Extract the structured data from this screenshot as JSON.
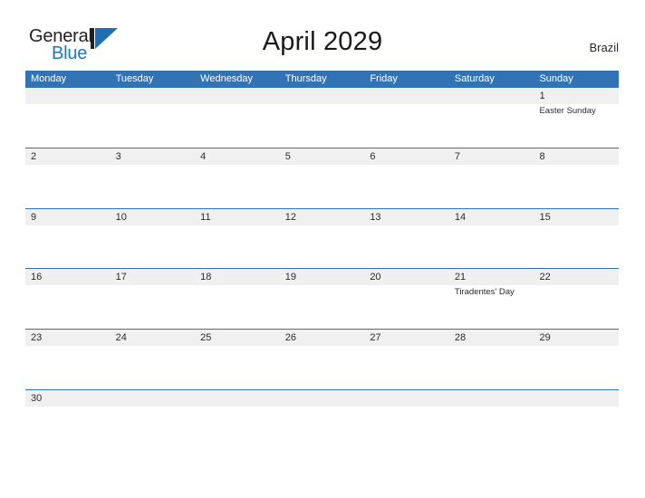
{
  "header": {
    "logo": {
      "word_one": "General",
      "word_two": "Blue",
      "mark": "triangle-logo-mark"
    },
    "title": "April 2029",
    "region": "Brazil"
  },
  "colors": {
    "header_blue": "#3173b4",
    "logo_blue": "#1878c8",
    "band_gray": "#f0f0f0",
    "text_dark": "#2b2b2b"
  },
  "calendar": {
    "weekdays": [
      "Monday",
      "Tuesday",
      "Wednesday",
      "Thursday",
      "Friday",
      "Saturday",
      "Sunday"
    ],
    "weeks": [
      [
        {
          "date": "",
          "event": ""
        },
        {
          "date": "",
          "event": ""
        },
        {
          "date": "",
          "event": ""
        },
        {
          "date": "",
          "event": ""
        },
        {
          "date": "",
          "event": ""
        },
        {
          "date": "",
          "event": ""
        },
        {
          "date": "1",
          "event": "Easter Sunday"
        }
      ],
      [
        {
          "date": "2",
          "event": ""
        },
        {
          "date": "3",
          "event": ""
        },
        {
          "date": "4",
          "event": ""
        },
        {
          "date": "5",
          "event": ""
        },
        {
          "date": "6",
          "event": ""
        },
        {
          "date": "7",
          "event": ""
        },
        {
          "date": "8",
          "event": ""
        }
      ],
      [
        {
          "date": "9",
          "event": ""
        },
        {
          "date": "10",
          "event": ""
        },
        {
          "date": "11",
          "event": ""
        },
        {
          "date": "12",
          "event": ""
        },
        {
          "date": "13",
          "event": ""
        },
        {
          "date": "14",
          "event": ""
        },
        {
          "date": "15",
          "event": ""
        }
      ],
      [
        {
          "date": "16",
          "event": ""
        },
        {
          "date": "17",
          "event": ""
        },
        {
          "date": "18",
          "event": ""
        },
        {
          "date": "19",
          "event": ""
        },
        {
          "date": "20",
          "event": ""
        },
        {
          "date": "21",
          "event": "Tiradentes' Day"
        },
        {
          "date": "22",
          "event": ""
        }
      ],
      [
        {
          "date": "23",
          "event": ""
        },
        {
          "date": "24",
          "event": ""
        },
        {
          "date": "25",
          "event": ""
        },
        {
          "date": "26",
          "event": ""
        },
        {
          "date": "27",
          "event": ""
        },
        {
          "date": "28",
          "event": ""
        },
        {
          "date": "29",
          "event": ""
        }
      ],
      [
        {
          "date": "30",
          "event": ""
        },
        {
          "date": "",
          "event": ""
        },
        {
          "date": "",
          "event": ""
        },
        {
          "date": "",
          "event": ""
        },
        {
          "date": "",
          "event": ""
        },
        {
          "date": "",
          "event": ""
        },
        {
          "date": "",
          "event": ""
        }
      ]
    ]
  }
}
